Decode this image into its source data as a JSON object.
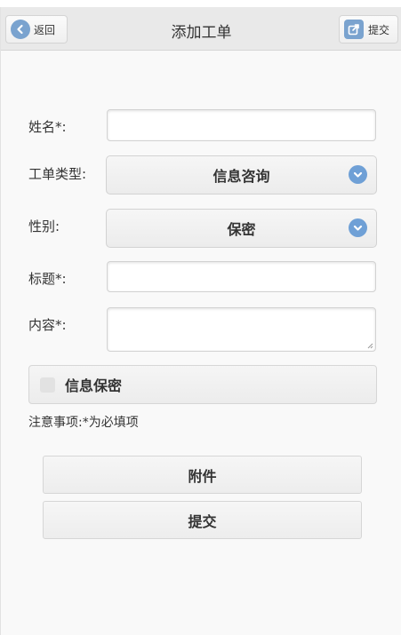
{
  "header": {
    "title": "添加工单",
    "back_label": "返回",
    "submit_label": "提交"
  },
  "form": {
    "name_label": "姓名*:",
    "type_label": "工单类型:",
    "type_value": "信息咨询",
    "gender_label": "性别:",
    "gender_value": "保密",
    "title_label": "标题*:",
    "content_label": "内容*:",
    "confidential_label": "信息保密",
    "note": "注意事项:*为必填项"
  },
  "actions": {
    "attachment_label": "附件",
    "submit_label": "提交"
  },
  "colors": {
    "accent": "#6fa0d6",
    "header_bg": "#e9e9e9",
    "page_bg": "#f9f9f9"
  }
}
